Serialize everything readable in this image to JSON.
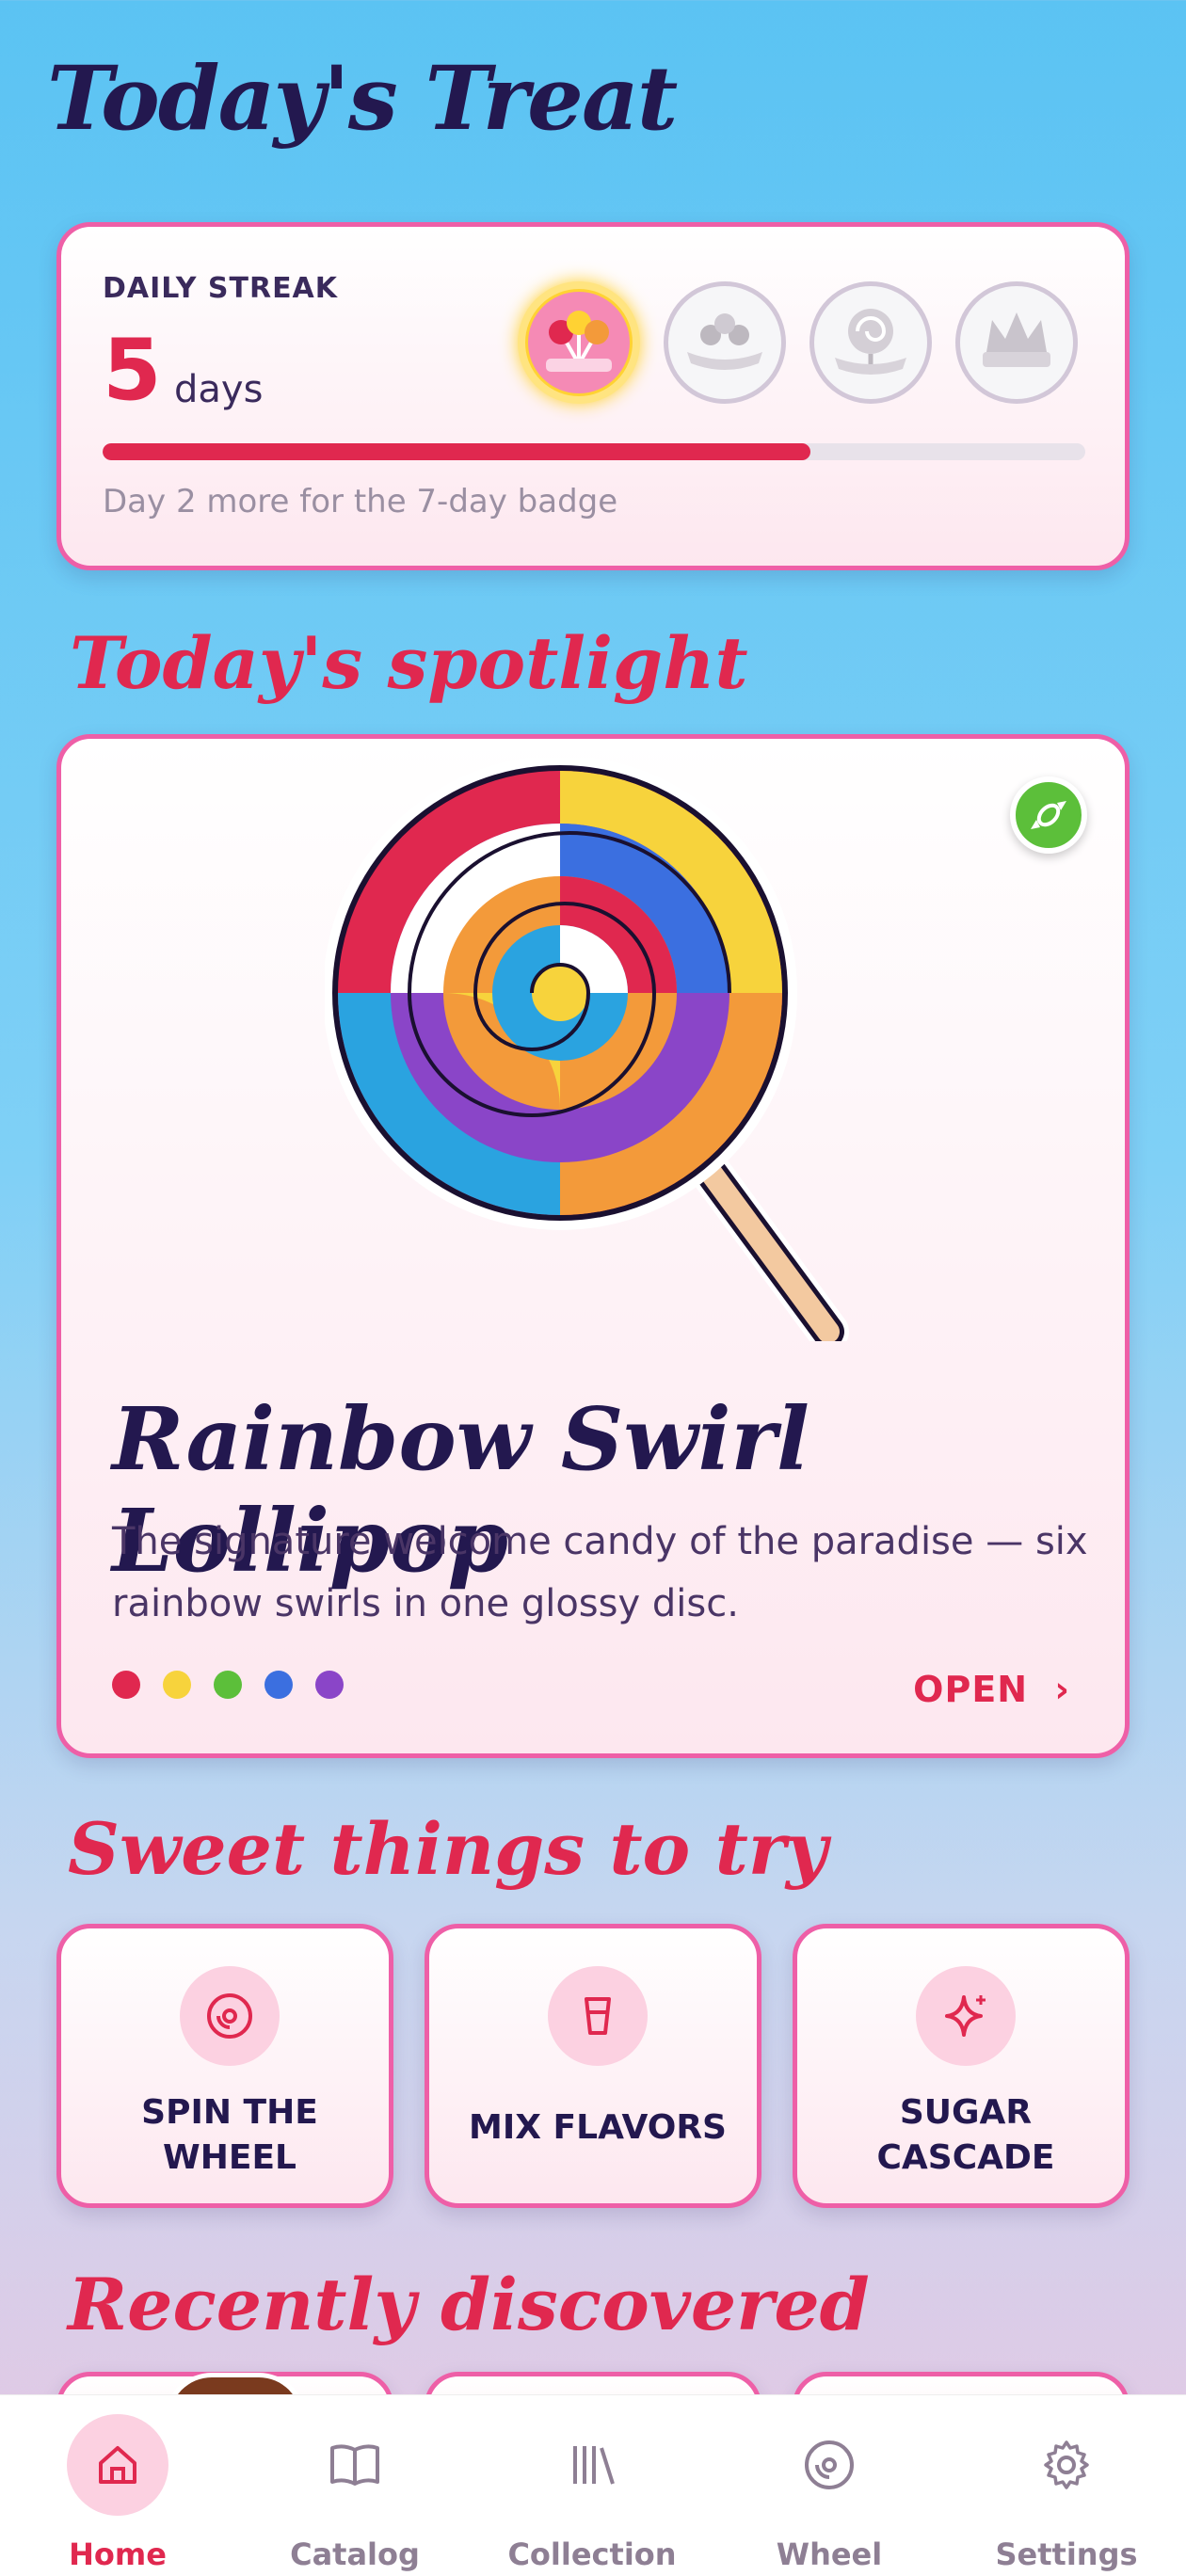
{
  "app": {
    "title": "Today's Treat"
  },
  "streak": {
    "label": "DAILY STREAK",
    "count": "5",
    "unit": "days",
    "progress": 0.72,
    "hint": "Day 2 more for the 7-day badge",
    "badges": [
      "lollipop-bouquet-badge",
      "chocolates-badge",
      "swirl-lollipop-badge",
      "candy-crown-badge"
    ]
  },
  "spotlight": {
    "heading": "Today's spotlight",
    "name": "Rainbow Swirl Lollipop",
    "description": "The signature welcome candy of the paradise — six rainbow swirls in one glossy disc.",
    "open_label": "OPEN",
    "swatches": [
      "#e0284f",
      "#f7d33c",
      "#5cbf3a",
      "#3b6fe0",
      "#8a45c8"
    ]
  },
  "try": {
    "heading": "Sweet things to try",
    "items": [
      {
        "label_1": "SPIN THE",
        "label_2": "WHEEL",
        "icon": "wheel-icon"
      },
      {
        "label_1": "MIX FLAVORS",
        "label_2": "",
        "icon": "cup-icon"
      },
      {
        "label_1": "SUGAR",
        "label_2": "CASCADE",
        "icon": "sparkle-icon"
      }
    ]
  },
  "recent": {
    "heading": "Recently discovered"
  },
  "nav": {
    "items": [
      {
        "label": "Home",
        "icon": "home-icon"
      },
      {
        "label": "Catalog",
        "icon": "book-icon"
      },
      {
        "label": "Collection",
        "icon": "library-icon"
      },
      {
        "label": "Wheel",
        "icon": "wheel-icon"
      },
      {
        "label": "Settings",
        "icon": "gear-icon"
      }
    ]
  }
}
